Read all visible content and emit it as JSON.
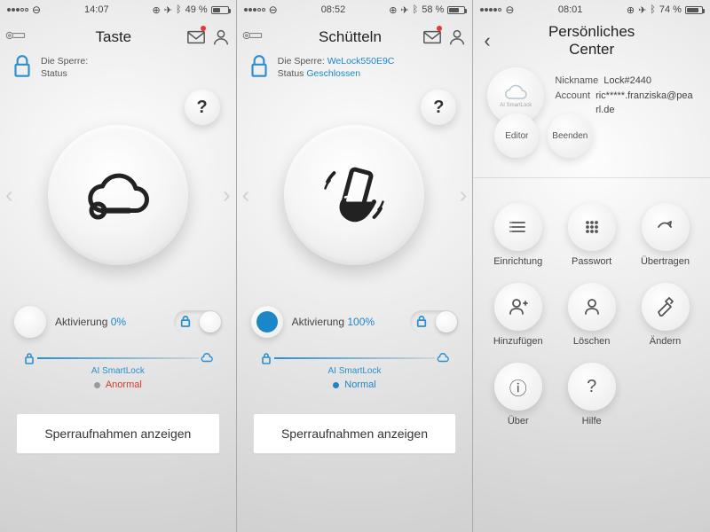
{
  "panelA": {
    "statusbar": {
      "carrier_icon": true,
      "time": "14:07",
      "battery_text": "49 %",
      "battery_fill": 49
    },
    "title": "Taste",
    "lock": {
      "label": "Die Sperre:",
      "value": "",
      "status_label": "Status",
      "status_value": ""
    },
    "activation": {
      "label": "Aktivierung",
      "percent": "0%",
      "orb_filled": false
    },
    "brand": "AI SmartLock",
    "status": {
      "text": "Anormal",
      "kind": "abn"
    },
    "button": "Sperraufnahmen anzeigen",
    "help": "?"
  },
  "panelB": {
    "statusbar": {
      "time": "08:52",
      "battery_text": "58 %",
      "battery_fill": 58
    },
    "title": "Schütteln",
    "lock": {
      "label": "Die Sperre:",
      "value": "WeLock550E9C",
      "status_label": "Status",
      "status_value": "Geschlossen"
    },
    "activation": {
      "label": "Aktivierung",
      "percent": "100%",
      "orb_filled": true
    },
    "brand": "AI SmartLock",
    "status": {
      "text": "Normal",
      "kind": "nor"
    },
    "button": "Sperraufnahmen anzeigen",
    "help": "?"
  },
  "panelC": {
    "statusbar": {
      "time": "08:01",
      "battery_text": "74 %",
      "battery_fill": 74
    },
    "title": "Persönliches Center",
    "avatar_caption": "AI SmartLock",
    "nickname": {
      "label": "Nickname",
      "value": "Lock#2440"
    },
    "account": {
      "label": "Account",
      "value": "ric*****.franziska@pearl.de"
    },
    "mini": {
      "editor": "Editor",
      "logout": "Beenden"
    },
    "grid": {
      "setup": "Einrichtung",
      "password": "Passwort",
      "transfer": "Übertragen",
      "add": "Hinzufügen",
      "delete": "Löschen",
      "change": "Ändern",
      "about": "Über",
      "help": "Hilfe"
    }
  }
}
